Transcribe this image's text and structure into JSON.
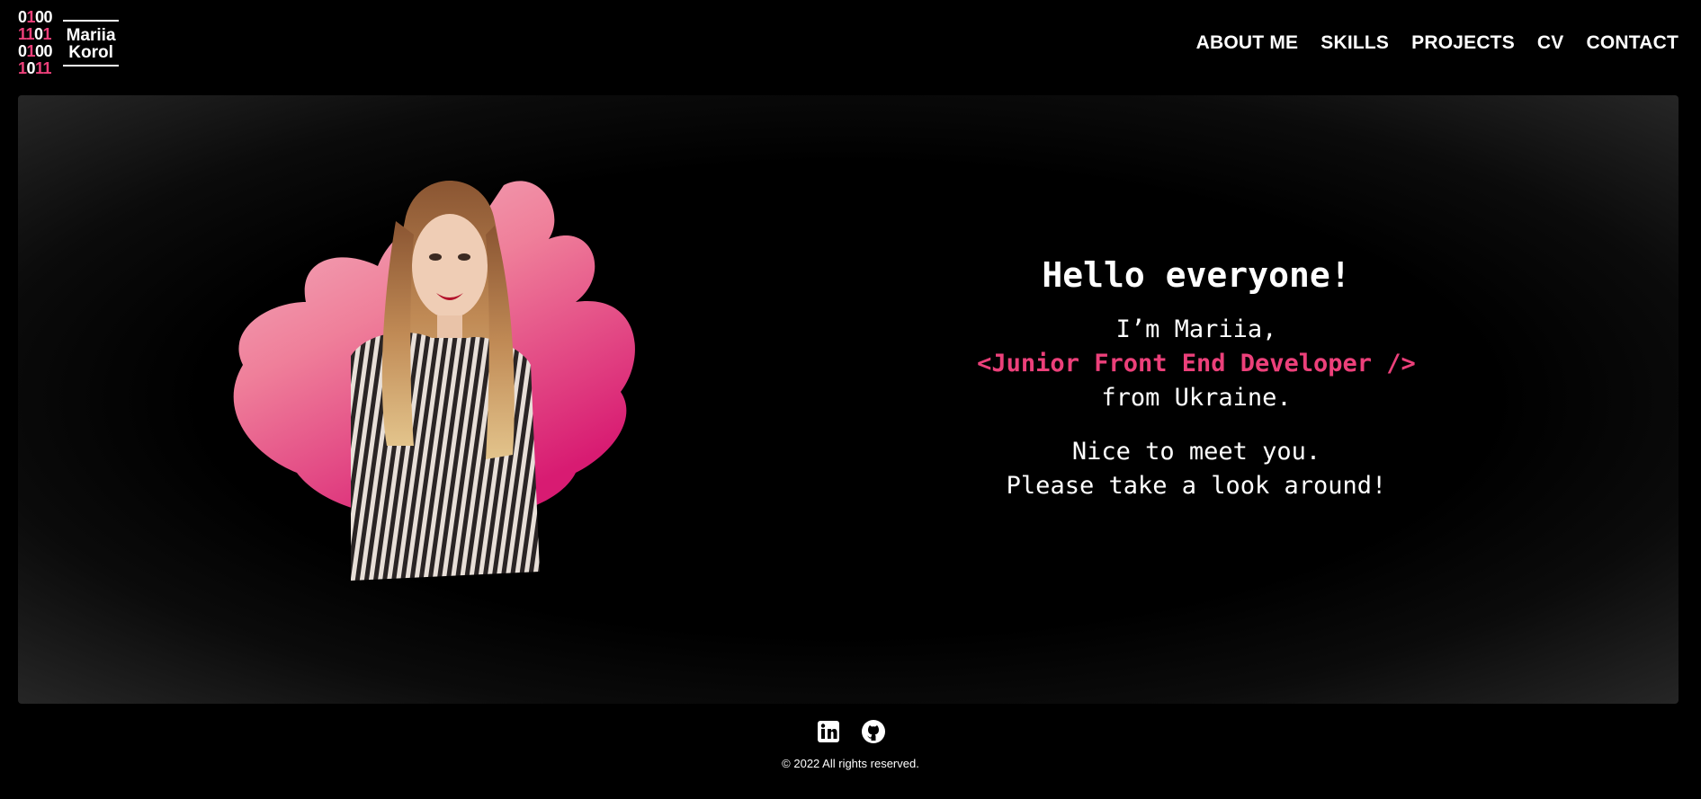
{
  "logo": {
    "bits": [
      "0100",
      "1101",
      "0100",
      "1011"
    ],
    "name_line1": "Mariia",
    "name_line2": "Korol"
  },
  "nav": {
    "items": [
      {
        "label": "ABOUT ME"
      },
      {
        "label": "SKILLS"
      },
      {
        "label": "PROJECTS"
      },
      {
        "label": "CV"
      },
      {
        "label": "CONTACT"
      }
    ]
  },
  "hero": {
    "greeting": "Hello everyone!",
    "intro_line": "I’m Mariia,",
    "role": "<Junior Front End Developer />",
    "origin": "from Ukraine.",
    "nice": "Nice to meet you.",
    "look": "Please take a look around!"
  },
  "footer": {
    "socials": [
      {
        "icon": "linkedin-icon"
      },
      {
        "icon": "github-icon"
      }
    ],
    "copyright": "© 2022 All rights reserved."
  },
  "colors": {
    "accent": "#ec407a",
    "background": "#000000"
  }
}
